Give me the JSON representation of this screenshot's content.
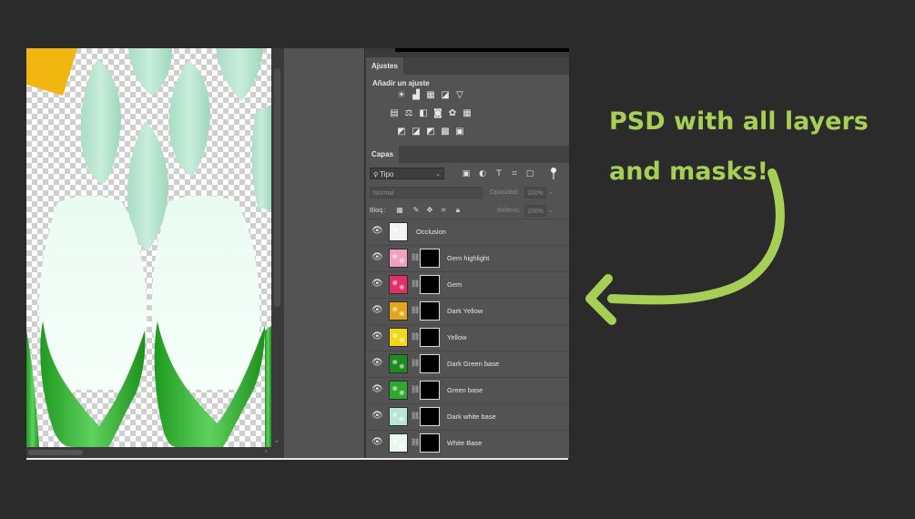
{
  "colors": {
    "background": "#2b2b2b",
    "panel": "#535353",
    "accent_green": "#a6cf55"
  },
  "panel": {
    "adjustments": {
      "tab": "Ajustes",
      "add_label": "Añadir un ajuste"
    },
    "layers": {
      "tab": "Capas",
      "filter_kind": "Tipo",
      "blend_mode": "Normal",
      "opacity_label": "Opacidad:",
      "opacity_value": "100%",
      "lock_label": "Bloq.:",
      "fill_label": "Relleno:",
      "fill_value": "100%",
      "items": [
        {
          "name": "Occlusion",
          "thumb_color": "#f2f2f2",
          "has_mask": false
        },
        {
          "name": "Gem highlight",
          "thumb_color": "#f0a0c0",
          "has_mask": true
        },
        {
          "name": "Gem",
          "thumb_color": "#e0306a",
          "has_mask": true
        },
        {
          "name": "Dark Yellow",
          "thumb_color": "#e6a61a",
          "has_mask": true
        },
        {
          "name": "Yellow",
          "thumb_color": "#f2d816",
          "has_mask": true
        },
        {
          "name": "Dark Green base",
          "thumb_color": "#1f8a1f",
          "has_mask": true
        },
        {
          "name": "Green base",
          "thumb_color": "#2fa82f",
          "has_mask": true
        },
        {
          "name": "Dark white base",
          "thumb_color": "#b8e6cf",
          "has_mask": true
        },
        {
          "name": "White Base",
          "thumb_color": "#e8f8ef",
          "has_mask": true
        }
      ]
    }
  },
  "annotation": {
    "line1": "PSD with all layers",
    "line2": "and masks!"
  }
}
